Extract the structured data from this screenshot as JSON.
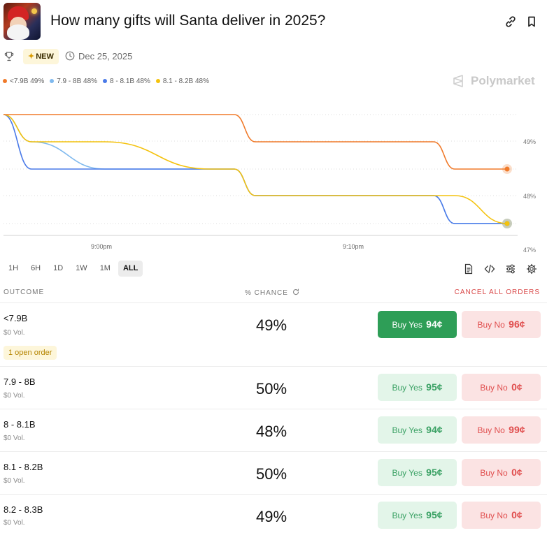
{
  "market": {
    "title": "How many gifts will Santa deliver in 2025?",
    "new_badge": "NEW",
    "date": "Dec 25, 2025",
    "brand": "Polymarket"
  },
  "icons": {
    "thumbnail": "santa-thumbnail",
    "link": "link-icon",
    "bookmark": "bookmark-icon",
    "trophy": "trophy-icon",
    "clock": "clock-icon",
    "document": "document-icon",
    "embed": "code-icon",
    "settings_sliders": "sliders-icon",
    "gear": "gear-icon",
    "refresh": "refresh-icon"
  },
  "legend": [
    {
      "label": "<7.9B 49%",
      "color": "#f07a2a"
    },
    {
      "label": "7.9 - 8B 48%",
      "color": "#7fb9ee"
    },
    {
      "label": "8 - 8.1B 48%",
      "color": "#4a7ae8"
    },
    {
      "label": "8.1 - 8.2B 48%",
      "color": "#f4c20d"
    }
  ],
  "chart_data": {
    "type": "line",
    "x_ticks": [
      "9:00pm",
      "9:10pm"
    ],
    "y_ticks": [
      "49%",
      "48%",
      "47%"
    ],
    "ylim": [
      47,
      50
    ],
    "grid": true,
    "series": [
      {
        "name": "<7.9B",
        "color": "#f07a2a",
        "values": [
          49.6,
          49.6,
          49.6,
          49.6,
          49.6,
          49.0,
          49.0,
          49.0,
          48.5,
          48.5
        ]
      },
      {
        "name": "7.9 - 8B",
        "color": "#7fb9ee",
        "values": [
          49.6,
          49.0,
          48.5,
          48.5,
          48.5,
          48.0,
          48.0,
          48.0,
          47.5,
          47.5
        ]
      },
      {
        "name": "8 - 8.1B",
        "color": "#4a7ae8",
        "values": [
          49.6,
          48.5,
          48.5,
          48.5,
          48.5,
          48.0,
          48.0,
          48.0,
          47.5,
          47.5
        ]
      },
      {
        "name": "8.1 - 8.2B",
        "color": "#f4c20d",
        "values": [
          49.6,
          49.0,
          49.0,
          48.5,
          48.5,
          48.0,
          48.0,
          48.0,
          48.0,
          47.5
        ]
      }
    ]
  },
  "ranges": [
    "1H",
    "6H",
    "1D",
    "1W",
    "1M",
    "ALL"
  ],
  "active_range": "ALL",
  "table": {
    "headers": {
      "outcome": "OUTCOME",
      "chance": "% CHANCE",
      "cancel": "CANCEL ALL ORDERS"
    },
    "buy_yes_label": "Buy Yes",
    "buy_no_label": "Buy No",
    "open_order_label": "1 open order",
    "rows": [
      {
        "name": "<7.9B",
        "vol": "$0 Vol.",
        "chance": "49%",
        "yes": "94¢",
        "no": "96¢"
      },
      {
        "name": "7.9 - 8B",
        "vol": "$0 Vol.",
        "chance": "50%",
        "yes": "95¢",
        "no": "0¢"
      },
      {
        "name": "8 - 8.1B",
        "vol": "$0 Vol.",
        "chance": "48%",
        "yes": "94¢",
        "no": "99¢"
      },
      {
        "name": "8.1 - 8.2B",
        "vol": "$0 Vol.",
        "chance": "50%",
        "yes": "95¢",
        "no": "0¢"
      },
      {
        "name": "8.2 - 8.3B",
        "vol": "$0 Vol.",
        "chance": "49%",
        "yes": "95¢",
        "no": "0¢"
      }
    ]
  }
}
